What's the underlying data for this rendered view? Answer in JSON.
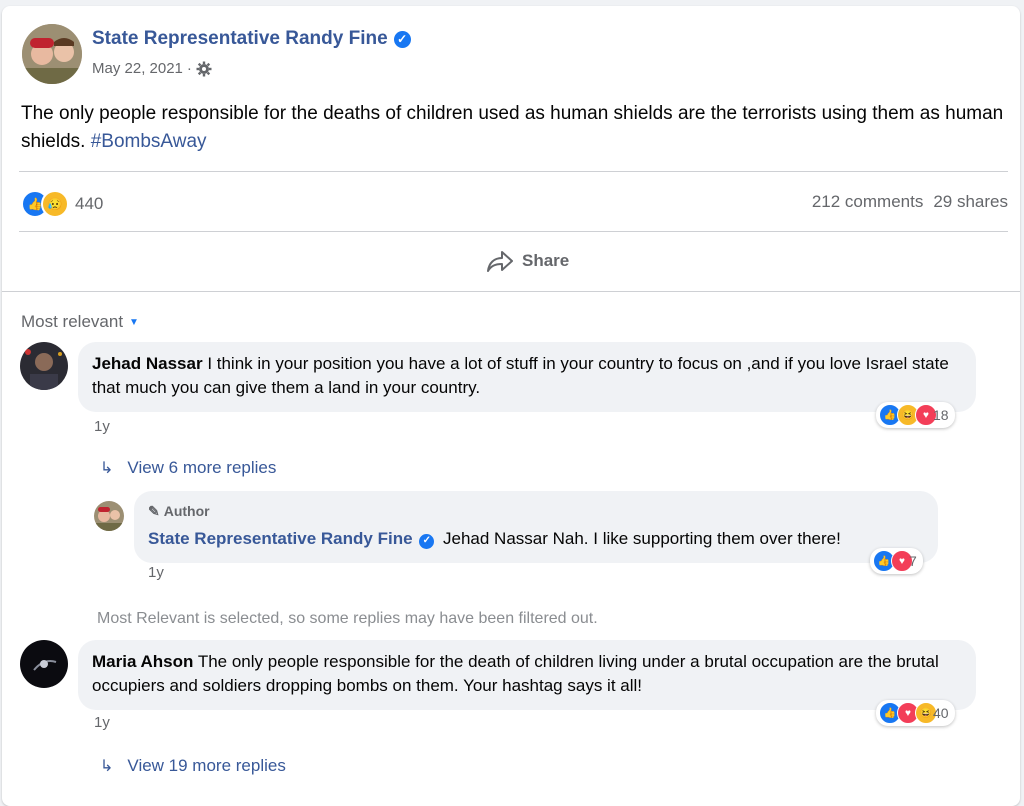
{
  "post": {
    "page_name": "State Representative Randy Fine",
    "date": "May 22, 2021",
    "separator": "·",
    "text": "The only people responsible for the deaths of children used as human shields are the terrorists using them as human shields.",
    "hashtag": "#BombsAway",
    "reaction_count": "440",
    "comments": "212 comments",
    "shares": "29 shares",
    "share_label": "Share"
  },
  "comments_section": {
    "sort_label": "Most relevant",
    "filter_note": "Most Relevant is selected, so some replies may have been filtered out."
  },
  "comments": [
    {
      "author": "Jehad Nassar",
      "text": "I think in your position you have a lot of stuff in your country to focus on ,and if you love Israel state that much you can give them a land in your country.",
      "time": "1y",
      "reactions": "18",
      "view_replies": "View 6 more replies"
    },
    {
      "author_badge": "Author",
      "author": "State Representative Randy Fine",
      "text": "Jehad Nassar Nah. I like supporting them over there!",
      "time": "1y",
      "reactions": "7"
    },
    {
      "author": "Maria Ahson",
      "text": "The only people responsible for the death of children living under a brutal occupation are the brutal occupiers and soldiers dropping bombs on them. Your hashtag says it all!",
      "time": "1y",
      "reactions": "40",
      "view_replies": "View 19 more replies"
    }
  ],
  "colors": {
    "link": "#385898",
    "like": "#1877f2",
    "love": "#f33e58",
    "haha": "#f7b928"
  }
}
